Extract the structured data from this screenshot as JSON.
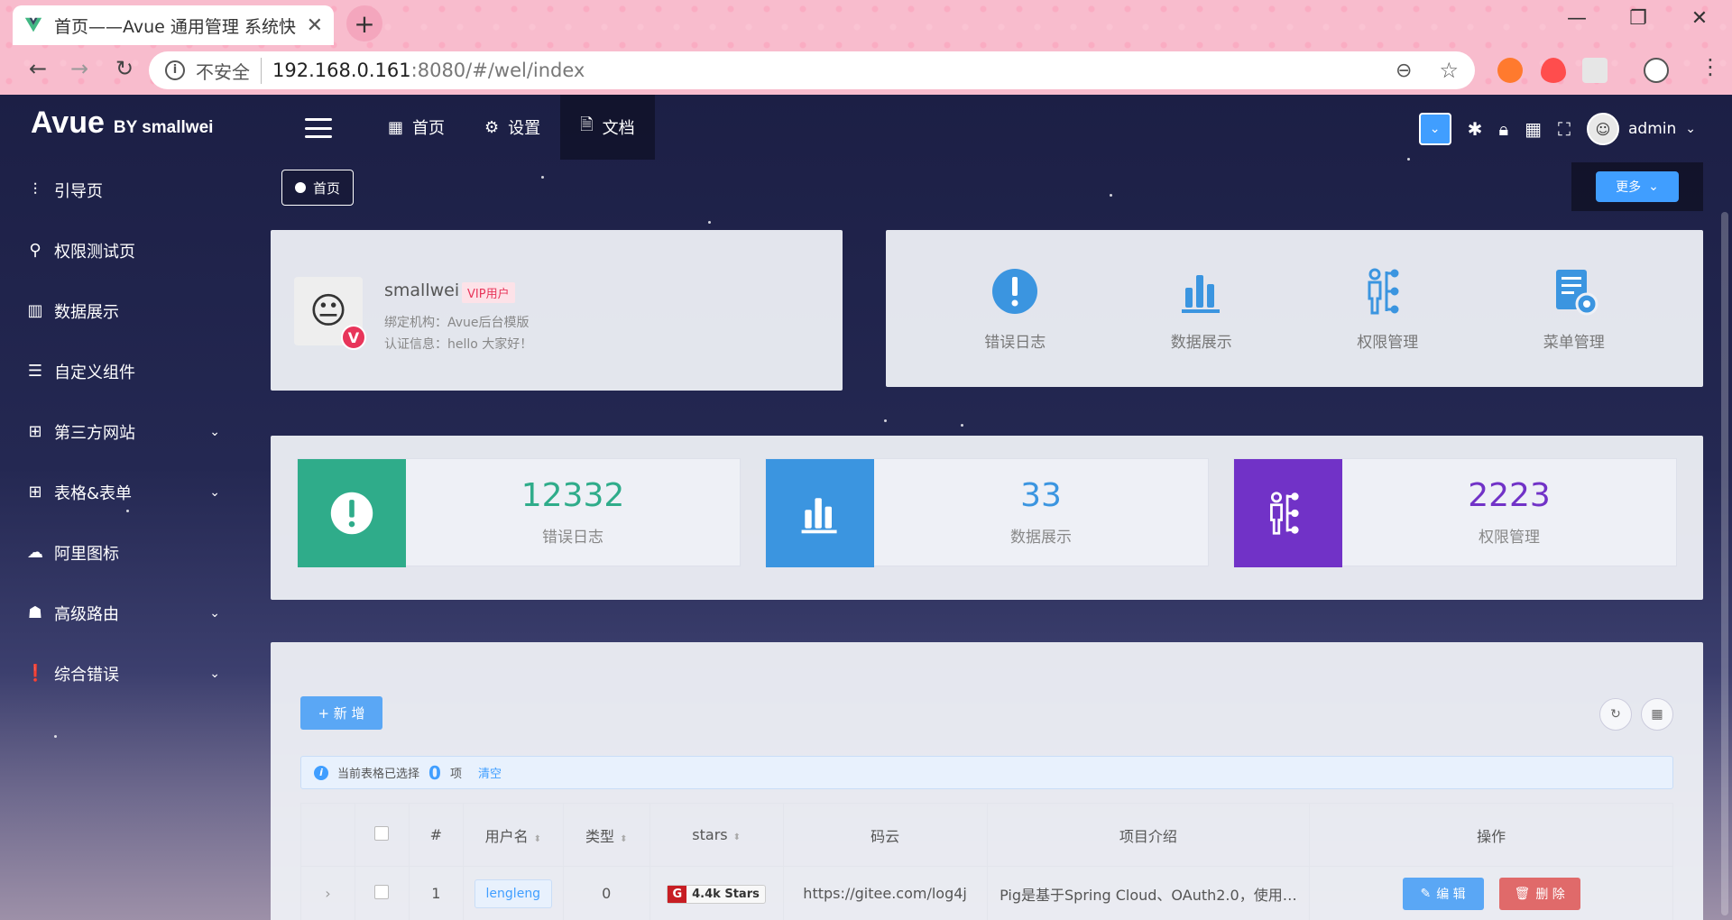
{
  "browser": {
    "tab_title": "首页——Avue 通用管理 系统快",
    "tab_close": "✕",
    "new_tab": "+",
    "url_insecure": "不安全",
    "url_host": "192.168.0.161",
    "url_rest": ":8080/#/wel/index",
    "icons": [
      "back-icon",
      "forward-icon",
      "reload-icon",
      "info-icon",
      "zoom-icon",
      "star-icon",
      "minimize-icon",
      "maximize-icon",
      "close-icon",
      "menu-icon"
    ]
  },
  "header": {
    "logo_main": "Avue",
    "logo_sub": "BY smallwei",
    "menu": [
      {
        "label": "首页",
        "icon": "grid-icon"
      },
      {
        "label": "设置",
        "icon": "gear-icon"
      },
      {
        "label": "文档",
        "icon": "document-icon"
      }
    ],
    "username": "admin"
  },
  "sidebar": {
    "items": [
      {
        "label": "引导页",
        "icon": "sliders-icon",
        "has_arrow": false
      },
      {
        "label": "权限测试页",
        "icon": "key-icon",
        "has_arrow": false
      },
      {
        "label": "数据展示",
        "icon": "bar-chart-icon",
        "has_arrow": false
      },
      {
        "label": "自定义组件",
        "icon": "list-icon",
        "has_arrow": false
      },
      {
        "label": "第三方网站",
        "icon": "table-icon",
        "has_arrow": true
      },
      {
        "label": "表格&表单",
        "icon": "grid-icon",
        "has_arrow": true
      },
      {
        "label": "阿里图标",
        "icon": "cloud-icon",
        "has_arrow": false
      },
      {
        "label": "高级路由",
        "icon": "cake-icon",
        "has_arrow": true
      },
      {
        "label": "综合错误",
        "icon": "alert-icon",
        "has_arrow": true
      }
    ]
  },
  "tags": {
    "home": "首页",
    "more": "更多"
  },
  "profile": {
    "name": "smallwei",
    "vip": "VIP用户",
    "org": "绑定机构：Avue后台模版",
    "cert": "认证信息：hello 大家好！"
  },
  "quick_links": [
    {
      "label": "错误日志",
      "icon": "alert-icon"
    },
    {
      "label": "数据展示",
      "icon": "bar-chart-icon"
    },
    {
      "label": "权限管理",
      "icon": "user-tree-icon"
    },
    {
      "label": "菜单管理",
      "icon": "doc-gear-icon"
    }
  ],
  "stats": [
    {
      "value": "12332",
      "label": "错误日志",
      "color": "#2fac8a",
      "icon": "alert-icon"
    },
    {
      "value": "33",
      "label": "数据展示",
      "color": "#3b95e0",
      "icon": "bar-chart-icon"
    },
    {
      "value": "2223",
      "label": "权限管理",
      "color": "#7132c7",
      "icon": "user-tree-icon"
    }
  ],
  "table": {
    "add_label": "+ 新 增",
    "alert_text": "当前表格已选择",
    "selected_count": "0",
    "alert_unit": "项",
    "clear_label": "清空",
    "columns": [
      "",
      "",
      "#",
      "用户名",
      "类型",
      "stars",
      "码云",
      "项目介绍",
      "操作"
    ],
    "rows": [
      {
        "index": "1",
        "username": "lengleng",
        "type": "0",
        "stars": "4.4k Stars",
        "gitee_mark": "G",
        "url": "https://gitee.com/log4j",
        "desc": "Pig是基于Spring Cloud、OAuth2.0，使用…"
      }
    ],
    "edit_label": "编 辑",
    "delete_label": "删 除"
  },
  "colors": {
    "primary": "#409eff",
    "danger": "#e06a6a",
    "sidebar_bg": "#1c1f45"
  }
}
